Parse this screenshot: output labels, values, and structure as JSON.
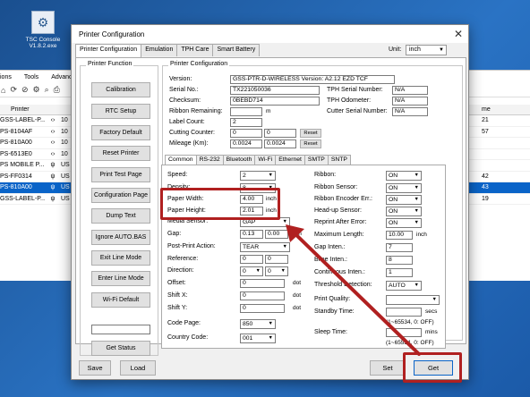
{
  "desktop": {
    "icon_label": "TSC Console V1.8.2.exe"
  },
  "background_app": {
    "menu": [
      "ions",
      "Tools",
      "Advanced"
    ],
    "header": {
      "printer": "Printer",
      "right": "me"
    },
    "rows": [
      {
        "name": "GSS-LABEL-P...",
        "num": "10"
      },
      {
        "name": "PS-8104AF",
        "num": "10"
      },
      {
        "name": "PS-810A00",
        "num": "10"
      },
      {
        "name": "PS-6513E0",
        "num": "10"
      },
      {
        "name": "PS MOBILE P...",
        "num": "US"
      },
      {
        "name": "PS-FF0314",
        "num": "US"
      },
      {
        "name": "PS-810A00",
        "num": "US"
      },
      {
        "name": "GSS-LABEL-P...",
        "num": "US"
      }
    ],
    "right_rows": [
      "21",
      "57",
      "",
      "",
      "",
      "42",
      "43",
      "19"
    ]
  },
  "dialog": {
    "title": "Printer Configuration",
    "close": "✕",
    "tabs": [
      "Printer Configuration",
      "Emulation",
      "TPH Care",
      "Smart Battery"
    ],
    "unit_label": "Unit:",
    "unit_value": "inch",
    "printer_function": {
      "title": "Printer Function",
      "buttons": [
        "Calibration",
        "RTC Setup",
        "Factory Default",
        "Reset Printer",
        "Print Test Page",
        "Configuration Page",
        "Dump Text",
        "Ignore AUTO.BAS",
        "Exit Line Mode",
        "Enter Line Mode",
        "Wi-Fi Default"
      ],
      "status_button": "Get Status"
    },
    "printer_config": {
      "title": "Printer Configuration",
      "version_label": "Version:",
      "version_value": "GSS-PTR-D-WIRELESS Version: A2.12 EZD TCF",
      "serial_label": "Serial No.:",
      "serial_value": "TX221050036",
      "checksum_label": "Checksum:",
      "checksum_value": "0BEBD714",
      "ribbon_rem_label": "Ribbon Remaining:",
      "ribbon_rem_unit": "m",
      "label_count_label": "Label Count:",
      "label_count_value": "2",
      "cutting_label": "Cutting Counter:",
      "cutting_a": "0",
      "cutting_b": "0",
      "mileage_label": "Mileage (Km):",
      "mileage_a": "0.0024",
      "mileage_b": "0.0024",
      "reset": "Reset",
      "tph_serial_label": "TPH Serial Number:",
      "tph_serial_value": "N/A",
      "tph_odo_label": "TPH Odometer:",
      "tph_odo_value": "N/A",
      "cutter_serial_label": "Cutter Serial Number:",
      "cutter_serial_value": "N/A"
    },
    "subtabs": [
      "Common",
      "RS-232",
      "Bluetooth",
      "Wi-Fi",
      "Ethernet",
      "SMTP",
      "SNTP"
    ],
    "common": {
      "speed_label": "Speed:",
      "speed_value": "2",
      "density_label": "Density:",
      "density_value": "8",
      "paper_width_label": "Paper Width:",
      "paper_width_value": "4.00",
      "paper_width_unit": "inch",
      "paper_height_label": "Paper Height:",
      "paper_height_value": "2.01",
      "paper_height_unit": "inch",
      "media_sensor_label": "Media Sensor:",
      "media_sensor_value": "GAP",
      "gap_label": "Gap:",
      "gap_a": "0.13",
      "gap_b": "0.00",
      "gap_unit": "inch",
      "post_print_label": "Post-Print Action:",
      "post_print_value": "TEAR",
      "reference_label": "Reference:",
      "reference_a": "0",
      "reference_b": "0",
      "direction_label": "Direction:",
      "direction_a": "0",
      "direction_b": "0",
      "offset_label": "Offset:",
      "offset_value": "0",
      "offset_unit": "dot",
      "shiftx_label": "Shift X:",
      "shiftx_value": "0",
      "shiftx_unit": "dot",
      "shifty_label": "Shift Y:",
      "shifty_value": "0",
      "shifty_unit": "dot",
      "codepage_label": "Code Page:",
      "codepage_value": "850",
      "country_label": "Country Code:",
      "country_value": "001",
      "ribbon_label": "Ribbon:",
      "ribbon_value": "ON",
      "ribbon_sensor_label": "Ribbon Sensor:",
      "ribbon_sensor_value": "ON",
      "ribbon_enc_label": "Ribbon Encoder Err.:",
      "ribbon_enc_value": "ON",
      "headup_label": "Head-up Sensor:",
      "headup_value": "ON",
      "reprint_label": "Reprint After Error:",
      "reprint_value": "ON",
      "maxlen_label": "Maximum Length:",
      "maxlen_value": "10.00",
      "maxlen_unit": "inch",
      "gapinten_label": "Gap Inten.:",
      "gapinten_value": "7",
      "bline_label": "Bline Inten.:",
      "bline_value": "8",
      "continuous_label": "Continuous Inten.:",
      "continuous_value": "1",
      "threshold_label": "Threshold Detection:",
      "threshold_value": "AUTO",
      "quality_label": "Print Quality:",
      "quality_value": "",
      "standby_label": "Standby Time:",
      "standby_unit": "secs",
      "standby_hint": "(1~65534, 0: OFF)",
      "sleep_label": "Sleep Time:",
      "sleep_unit": "mins",
      "sleep_hint": "(1~65534, 0: OFF)"
    },
    "buttons": {
      "save": "Save",
      "load": "Load",
      "set": "Set",
      "get": "Get"
    }
  },
  "colors": {
    "highlight": "#b02020",
    "selection": "#0a64c8"
  }
}
